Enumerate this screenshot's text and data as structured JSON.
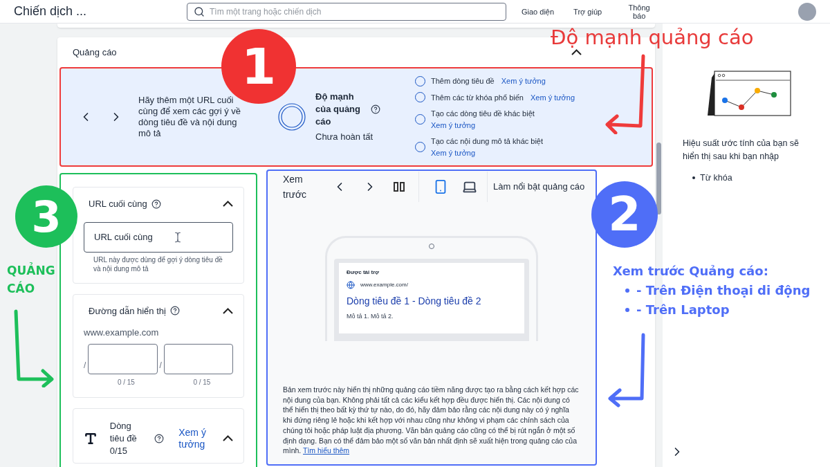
{
  "header": {
    "title": "Chiến dịch ...",
    "search": {
      "placeholder": "Tìm một trang hoặc chiến dịch"
    },
    "actions": [
      "Giao diện",
      "Trợ giúp",
      "Thông báo"
    ]
  },
  "ad_card": {
    "title": "Quảng cáo",
    "expanded": true,
    "strength": {
      "hint": "Hãy thêm một URL cuối cùng để xem các gợi ý về dòng tiêu đề và nội dung mô tả",
      "label": "Độ mạnh của quảng cáo",
      "status": "Chưa hoàn tất",
      "suggestions": [
        {
          "text": "Thêm dòng tiêu đề",
          "link": "Xem ý tưởng",
          "checked": false
        },
        {
          "text": "Thêm các từ khóa phổ biến",
          "link": "Xem ý tưởng",
          "checked": false
        },
        {
          "text": "Tạo các dòng tiêu đề khác biệt",
          "link": "Xem ý tưởng",
          "checked": false
        },
        {
          "text": "Tạo các nội dung mô tả khác biệt",
          "link": "Xem ý tưởng",
          "checked": false
        }
      ]
    },
    "final_url": {
      "title": "URL cuối cùng",
      "expanded": true,
      "placeholder": "URL cuối cùng",
      "help": "URL này được dùng để gợi ý dòng tiêu đề và nội dung mô tả"
    },
    "display_path": {
      "title": "Đường dẫn hiển thị",
      "expanded": true,
      "domain": "www.example.com",
      "paths": [
        {
          "separator": "/",
          "counter": "0 / 15"
        },
        {
          "separator": "/",
          "counter": "0 / 15"
        }
      ]
    },
    "headlines": {
      "title": "Dòng tiêu đề",
      "count": "0/15",
      "link": "Xem ý tưởng",
      "expanded": true
    },
    "preview": {
      "title": "Xem trước",
      "devices": [
        {
          "kind": "mobile",
          "selected": true
        },
        {
          "kind": "laptop",
          "selected": false
        }
      ],
      "highlight": "Làm nổi bật quảng cáo",
      "ad": {
        "sponsored": "Được tài trợ",
        "url": "www.example.com/",
        "headline": "Dòng tiêu đề 1 - Dòng tiêu đề 2",
        "description": "Mô tả 1. Mô tả 2."
      },
      "note": "Bản xem trước này hiển thị những quảng cáo tiềm năng được tạo ra bằng cách kết hợp các nội dung của bạn. Không phải tất cả các kiểu kết hợp đều được hiển thị. Các nội dung có thể hiển thị theo bất kỳ thứ tự nào, do đó, hãy đảm bảo rằng các nội dung này có ý nghĩa khi đứng riêng lẻ hoặc khi kết hợp với nhau cũng như không vi phạm các chính sách của chúng tôi hoặc pháp luật địa phương. Văn bản quảng cáo cũng có thể bị rút ngắn ở một số định dạng. Bạn có thể đảm bảo một số văn bản nhất định sẽ xuất hiện trong quảng cáo của mình.",
      "note_link": "Tìm hiểu thêm"
    }
  },
  "side_panel": {
    "text": "Hiệu suất ước tính của bạn sẽ hiển thị sau khi bạn nhập",
    "items": [
      "Từ khóa"
    ]
  },
  "annotations": {
    "strength": {
      "number": "1",
      "label": "Độ mạnh quảng cáo"
    },
    "preview": {
      "number": "2",
      "title": "Xem trước Quảng cáo:",
      "items": [
        "- Trên Điện thoại di động",
        "- Trên Laptop"
      ]
    },
    "form": {
      "number": "3",
      "label": "QUẢNG CÁO"
    }
  }
}
